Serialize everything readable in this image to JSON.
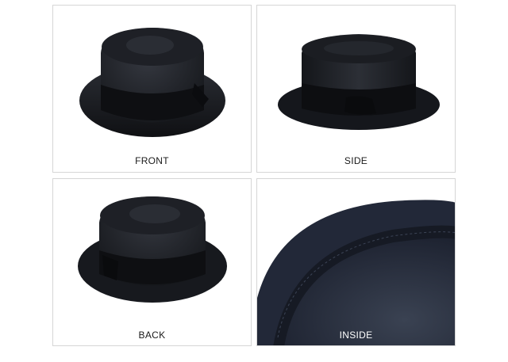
{
  "gallery": {
    "panels": [
      {
        "label": "FRONT"
      },
      {
        "label": "SIDE"
      },
      {
        "label": "BACK"
      },
      {
        "label": "INSIDE"
      }
    ]
  },
  "colors": {
    "hat": "#1b1d22",
    "band": "#0f1013",
    "felt_inside": "#2a3140",
    "border": "#d6d6d6"
  }
}
